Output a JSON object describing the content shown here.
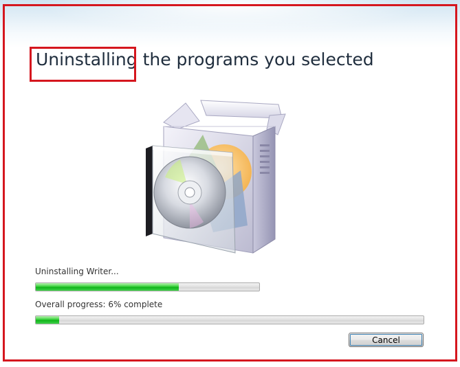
{
  "heading": {
    "highlighted_word": "Uninstalling",
    "rest": " the programs you selected"
  },
  "illustration": {
    "icon": "software-box-cd-icon"
  },
  "current_task": {
    "label": "Uninstalling Writer...",
    "progress_fraction": 0.64
  },
  "overall": {
    "label": "Overall progress: 6% complete",
    "progress_percent": 6
  },
  "actions": {
    "cancel_label": "Cancel"
  },
  "colors": {
    "annotation_red": "#d5161e",
    "progress_green": "#22c22c"
  }
}
